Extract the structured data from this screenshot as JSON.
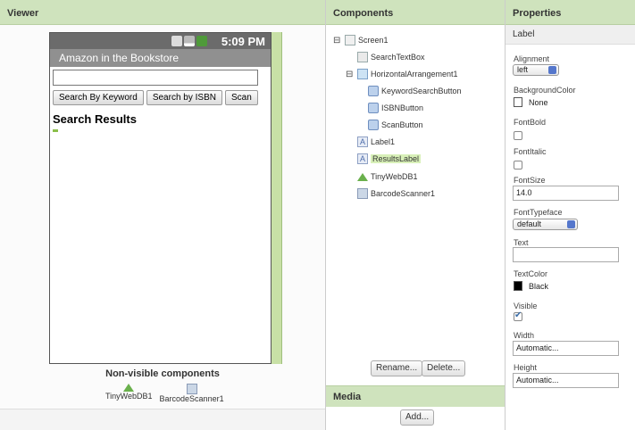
{
  "panels": {
    "viewer": "Viewer",
    "components": "Components",
    "properties": "Properties",
    "media": "Media"
  },
  "phone": {
    "clock": "5:09 PM",
    "title": "Amazon in the Bookstore",
    "search_value": "",
    "buttons": [
      "Search By Keyword",
      "Search by ISBN",
      "Scan"
    ],
    "results_label": "Search Results"
  },
  "nonvisible": {
    "title": "Non-visible components",
    "items": [
      "TinyWebDB1",
      "BarcodeScanner1"
    ]
  },
  "tree": {
    "screen": "Screen1",
    "search_textbox": "SearchTextBox",
    "harr": "HorizontalArrangement1",
    "kw_button": "KeywordSearchButton",
    "isbn_button": "ISBNButton",
    "scan_button": "ScanButton",
    "label1": "Label1",
    "results_label": "ResultsLabel",
    "tinydb": "TinyWebDB1",
    "barcode": "BarcodeScanner1",
    "selected": "ResultsLabel"
  },
  "comp_buttons": {
    "rename": "Rename...",
    "delete": "Delete..."
  },
  "media": {
    "add": "Add..."
  },
  "properties": {
    "component": "Label",
    "alignment_label": "Alignment",
    "alignment_value": "left",
    "bgcolor_label": "BackgroundColor",
    "bgcolor_value": "None",
    "fontbold_label": "FontBold",
    "fontbold_checked": false,
    "fontitalic_label": "FontItalic",
    "fontitalic_checked": false,
    "fontsize_label": "FontSize",
    "fontsize_value": "14.0",
    "fonttypeface_label": "FontTypeface",
    "fonttypeface_value": "default",
    "text_label": "Text",
    "text_value": "",
    "textcolor_label": "TextColor",
    "textcolor_value": "Black",
    "visible_label": "Visible",
    "visible_checked": true,
    "width_label": "Width",
    "width_value": "Automatic...",
    "height_label": "Height",
    "height_value": "Automatic..."
  },
  "colors": {
    "header_bg": "#cfe3bd",
    "selected_bg": "#d8f0b8",
    "textcolor_swatch": "#000000"
  }
}
